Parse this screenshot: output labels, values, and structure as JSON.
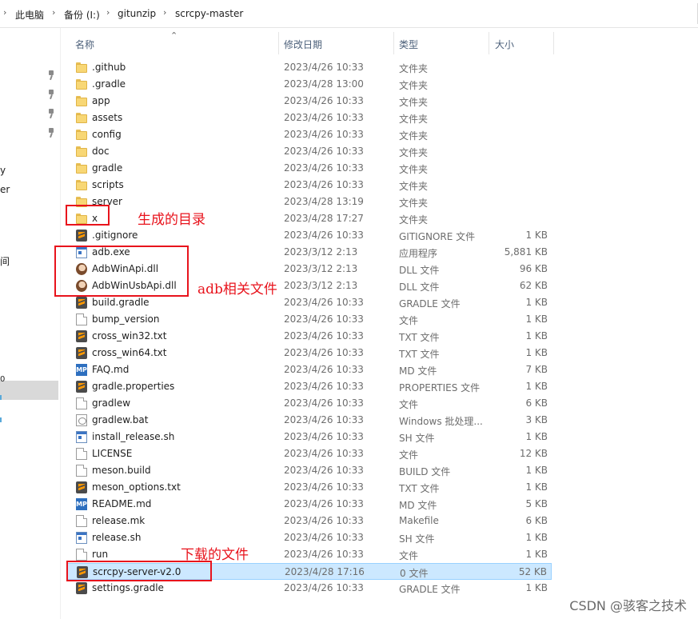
{
  "breadcrumb": {
    "items": [
      "此电脑",
      "备份 (I:)",
      "gitunzip",
      "scrcpy-master"
    ],
    "separator": "›"
  },
  "nav_fragments": [
    "y",
    "er",
    "间",
    "0"
  ],
  "columns": {
    "name": "名称",
    "date": "修改日期",
    "type": "类型",
    "size": "大小"
  },
  "files": [
    {
      "name": ".github",
      "date": "2023/4/26 10:33",
      "type": "文件夹",
      "size": "",
      "icon": "folder-icon"
    },
    {
      "name": ".gradle",
      "date": "2023/4/28 13:00",
      "type": "文件夹",
      "size": "",
      "icon": "folder-icon"
    },
    {
      "name": "app",
      "date": "2023/4/26 10:33",
      "type": "文件夹",
      "size": "",
      "icon": "folder-icon"
    },
    {
      "name": "assets",
      "date": "2023/4/26 10:33",
      "type": "文件夹",
      "size": "",
      "icon": "folder-icon"
    },
    {
      "name": "config",
      "date": "2023/4/26 10:33",
      "type": "文件夹",
      "size": "",
      "icon": "folder-icon"
    },
    {
      "name": "doc",
      "date": "2023/4/26 10:33",
      "type": "文件夹",
      "size": "",
      "icon": "folder-icon"
    },
    {
      "name": "gradle",
      "date": "2023/4/26 10:33",
      "type": "文件夹",
      "size": "",
      "icon": "folder-icon"
    },
    {
      "name": "scripts",
      "date": "2023/4/26 10:33",
      "type": "文件夹",
      "size": "",
      "icon": "folder-icon"
    },
    {
      "name": "server",
      "date": "2023/4/28 13:19",
      "type": "文件夹",
      "size": "",
      "icon": "folder-icon"
    },
    {
      "name": "x",
      "date": "2023/4/28 17:27",
      "type": "文件夹",
      "size": "",
      "icon": "folder-icon"
    },
    {
      "name": ".gitignore",
      "date": "2023/4/26 10:33",
      "type": "GITIGNORE 文件",
      "size": "1 KB",
      "icon": "sublime-text-icon"
    },
    {
      "name": "adb.exe",
      "date": "2023/3/12 2:13",
      "type": "应用程序",
      "size": "5,881 KB",
      "icon": "application-icon"
    },
    {
      "name": "AdbWinApi.dll",
      "date": "2023/3/12 2:13",
      "type": "DLL 文件",
      "size": "96 KB",
      "icon": "dll-icon"
    },
    {
      "name": "AdbWinUsbApi.dll",
      "date": "2023/3/12 2:13",
      "type": "DLL 文件",
      "size": "62 KB",
      "icon": "dll-icon"
    },
    {
      "name": "build.gradle",
      "date": "2023/4/26 10:33",
      "type": "GRADLE 文件",
      "size": "1 KB",
      "icon": "sublime-text-icon"
    },
    {
      "name": "bump_version",
      "date": "2023/4/26 10:33",
      "type": "文件",
      "size": "1 KB",
      "icon": "document-icon"
    },
    {
      "name": "cross_win32.txt",
      "date": "2023/4/26 10:33",
      "type": "TXT 文件",
      "size": "1 KB",
      "icon": "sublime-text-icon"
    },
    {
      "name": "cross_win64.txt",
      "date": "2023/4/26 10:33",
      "type": "TXT 文件",
      "size": "1 KB",
      "icon": "sublime-text-icon"
    },
    {
      "name": "FAQ.md",
      "date": "2023/4/26 10:33",
      "type": "MD 文件",
      "size": "7 KB",
      "icon": "markdown-icon"
    },
    {
      "name": "gradle.properties",
      "date": "2023/4/26 10:33",
      "type": "PROPERTIES 文件",
      "size": "1 KB",
      "icon": "sublime-text-icon"
    },
    {
      "name": "gradlew",
      "date": "2023/4/26 10:33",
      "type": "文件",
      "size": "6 KB",
      "icon": "document-icon"
    },
    {
      "name": "gradlew.bat",
      "date": "2023/4/26 10:33",
      "type": "Windows 批处理...",
      "size": "3 KB",
      "icon": "batch-file-icon"
    },
    {
      "name": "install_release.sh",
      "date": "2023/4/26 10:33",
      "type": "SH 文件",
      "size": "1 KB",
      "icon": "application-icon"
    },
    {
      "name": "LICENSE",
      "date": "2023/4/26 10:33",
      "type": "文件",
      "size": "12 KB",
      "icon": "document-icon"
    },
    {
      "name": "meson.build",
      "date": "2023/4/26 10:33",
      "type": "BUILD 文件",
      "size": "1 KB",
      "icon": "document-icon"
    },
    {
      "name": "meson_options.txt",
      "date": "2023/4/26 10:33",
      "type": "TXT 文件",
      "size": "1 KB",
      "icon": "sublime-text-icon"
    },
    {
      "name": "README.md",
      "date": "2023/4/26 10:33",
      "type": "MD 文件",
      "size": "5 KB",
      "icon": "markdown-icon"
    },
    {
      "name": "release.mk",
      "date": "2023/4/26 10:33",
      "type": "Makefile",
      "size": "6 KB",
      "icon": "document-icon"
    },
    {
      "name": "release.sh",
      "date": "2023/4/26 10:33",
      "type": "SH 文件",
      "size": "1 KB",
      "icon": "application-icon"
    },
    {
      "name": "run",
      "date": "2023/4/26 10:33",
      "type": "文件",
      "size": "1 KB",
      "icon": "document-icon"
    },
    {
      "name": "scrcpy-server-v2.0",
      "date": "2023/4/28 17:16",
      "type": "0 文件",
      "size": "52 KB",
      "icon": "sublime-text-icon",
      "selected": true
    },
    {
      "name": "settings.gradle",
      "date": "2023/4/26 10:33",
      "type": "GRADLE 文件",
      "size": "1 KB",
      "icon": "sublime-text-icon"
    }
  ],
  "annotations": {
    "generated_dir": "生成的目录",
    "adb_files": "adb相关文件",
    "downloaded_file": "下载的文件",
    "color": "#e8131c"
  },
  "watermark": "CSDN @骇客之技术",
  "colors": {
    "selection": "#cce8ff",
    "header_text": "#4c607a",
    "folder": "#f8d775"
  }
}
